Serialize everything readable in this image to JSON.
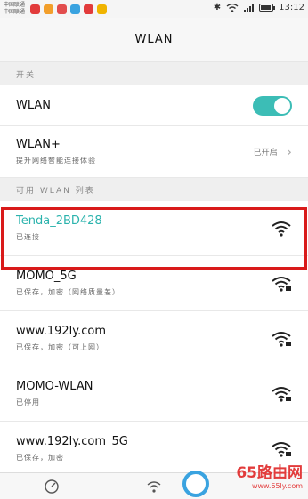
{
  "statusbar": {
    "carrier_line1": "中国联通",
    "carrier_line2": "中国联通",
    "time": "13:12",
    "app_colors": [
      "#e23b3b",
      "#f29f2b",
      "#e24d4d",
      "#3aa3e0",
      "#e23b3b",
      "#f0b400"
    ]
  },
  "header": {
    "title": "WLAN"
  },
  "sections": {
    "switch_header": "开关",
    "available_header": "可用 WLAN 列表"
  },
  "wlan_toggle": {
    "label": "WLAN",
    "enabled": true
  },
  "wlan_plus": {
    "label": "WLAN+",
    "subtitle": "提升网络智能连接体验",
    "status": "已开启"
  },
  "networks": [
    {
      "ssid": "Tenda_2BD428",
      "status": "已连接",
      "connected": true,
      "locked": false
    },
    {
      "ssid": "MOMO_5G",
      "status": "已保存，加密（网络质量差）",
      "connected": false,
      "locked": true
    },
    {
      "ssid": "www.192ly.com",
      "status": "已保存，加密（可上网）",
      "connected": false,
      "locked": true
    },
    {
      "ssid": "MOMO-WLAN",
      "status": "已停用",
      "connected": false,
      "locked": true
    },
    {
      "ssid": "www.192ly.com_5G",
      "status": "已保存，加密",
      "connected": false,
      "locked": true
    }
  ],
  "watermark": {
    "main": "65路由网",
    "sub": "www.65ly.com"
  },
  "colors": {
    "accent": "#3cbdb6",
    "highlight": "#d91a1a"
  }
}
